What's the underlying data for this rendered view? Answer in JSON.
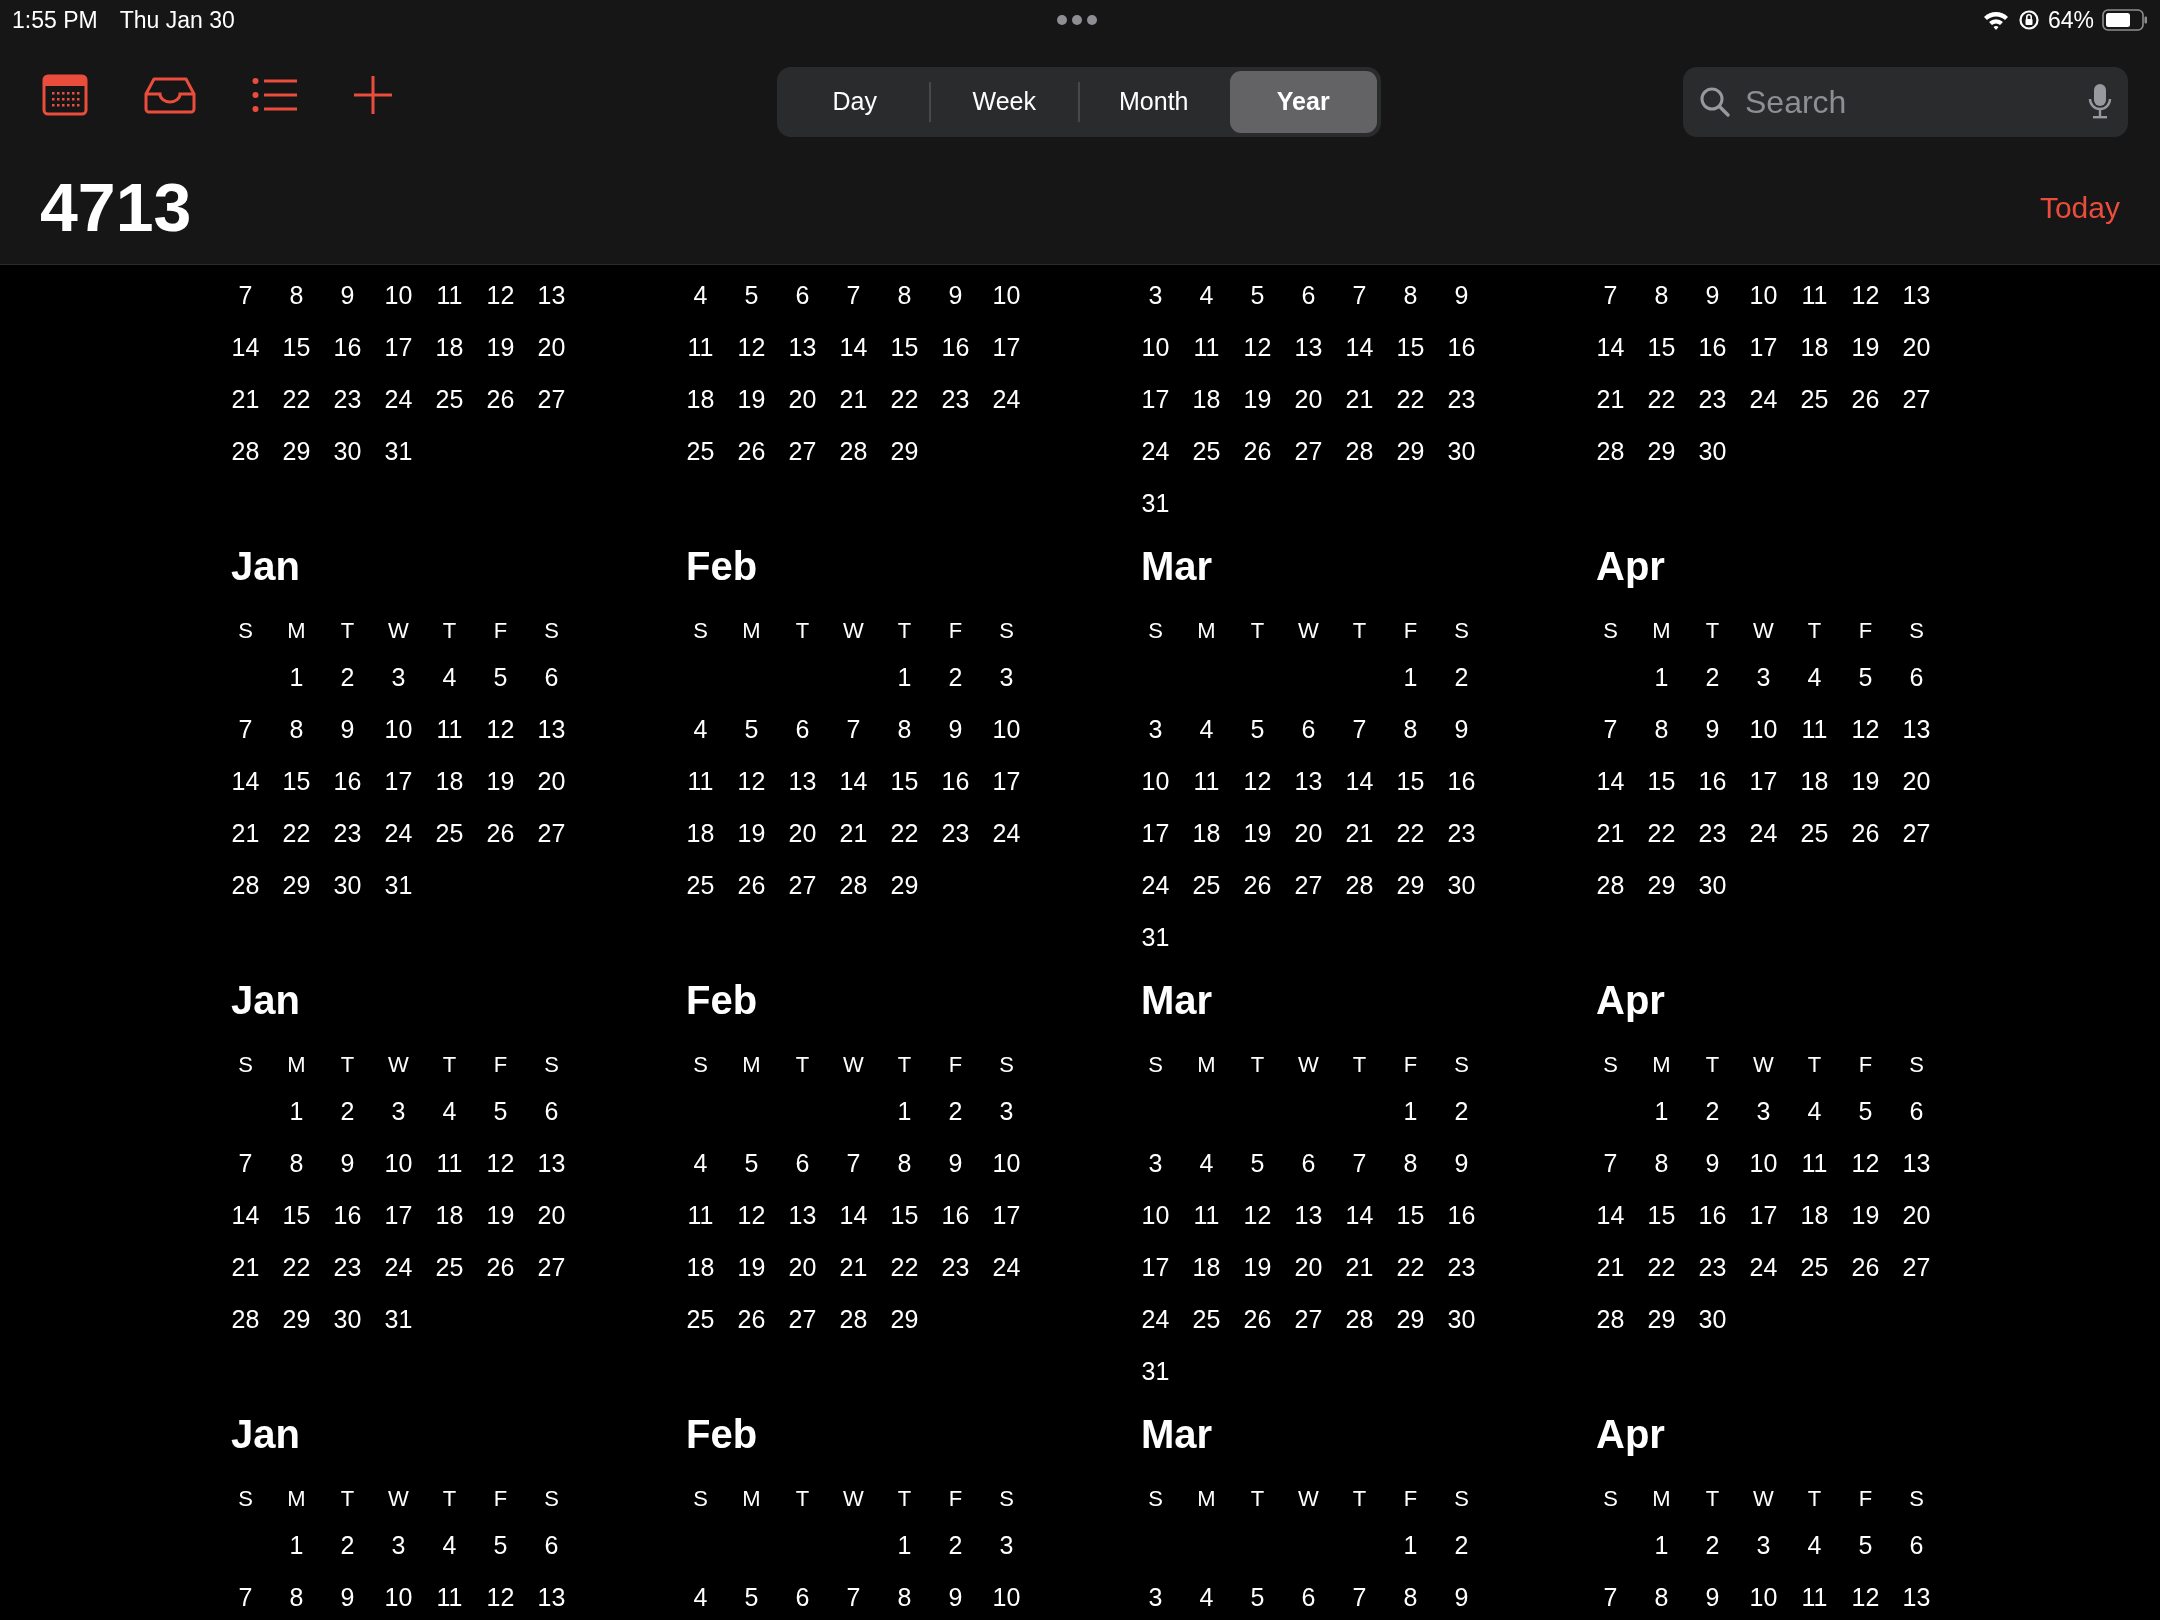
{
  "status_bar": {
    "time": "1:55 PM",
    "date": "Thu Jan 30",
    "battery": "64%"
  },
  "toolbar": {
    "view_tabs": [
      {
        "label": "Day",
        "selected": false
      },
      {
        "label": "Week",
        "selected": false
      },
      {
        "label": "Month",
        "selected": false
      },
      {
        "label": "Year",
        "selected": true
      }
    ],
    "search": {
      "placeholder": "Search"
    }
  },
  "title": "4713",
  "today_button": "Today",
  "sections": [
    {
      "months": [
        {
          "weeks": [
            {
              "kind": "week",
              "days": [
                "7",
                "8",
                "9",
                "10",
                "11",
                "12",
                "13"
              ]
            },
            {
              "kind": "week",
              "days": [
                "14",
                "15",
                "16",
                "17",
                "18",
                "19",
                "20"
              ]
            },
            {
              "kind": "week",
              "days": [
                "21",
                "22",
                "23",
                "24",
                "25",
                "26",
                "27"
              ]
            },
            {
              "kind": "week",
              "days": [
                "28",
                "29",
                "30",
                "31"
              ]
            }
          ]
        },
        {
          "weeks": [
            {
              "kind": "week",
              "days": [
                "4",
                "5",
                "6",
                "7",
                "8",
                "9",
                "10"
              ]
            },
            {
              "kind": "week",
              "days": [
                "11",
                "12",
                "13",
                "14",
                "15",
                "16",
                "17"
              ]
            },
            {
              "kind": "week",
              "days": [
                "18",
                "19",
                "20",
                "21",
                "22",
                "23",
                "24"
              ]
            },
            {
              "kind": "week",
              "days": [
                "25",
                "26",
                "27",
                "28",
                "29"
              ]
            }
          ]
        },
        {
          "weeks": [
            {
              "kind": "week",
              "days": [
                "3",
                "4",
                "5",
                "6",
                "7",
                "8",
                "9"
              ]
            },
            {
              "kind": "week",
              "days": [
                "10",
                "11",
                "12",
                "13",
                "14",
                "15",
                "16"
              ]
            },
            {
              "kind": "week",
              "days": [
                "17",
                "18",
                "19",
                "20",
                "21",
                "22",
                "23"
              ]
            },
            {
              "kind": "week",
              "days": [
                "24",
                "25",
                "26",
                "27",
                "28",
                "29",
                "30"
              ]
            },
            {
              "kind": "week",
              "days": [
                "31"
              ]
            }
          ]
        },
        {
          "weeks": [
            {
              "kind": "week",
              "days": [
                "7",
                "8",
                "9",
                "10",
                "11",
                "12",
                "13"
              ]
            },
            {
              "kind": "week",
              "days": [
                "14",
                "15",
                "16",
                "17",
                "18",
                "19",
                "20"
              ]
            },
            {
              "kind": "week",
              "days": [
                "21",
                "22",
                "23",
                "24",
                "25",
                "26",
                "27"
              ]
            },
            {
              "kind": "week",
              "days": [
                "28",
                "29",
                "30"
              ]
            }
          ]
        }
      ]
    },
    {
      "months": [
        {
          "name": "Jan",
          "weekdays": [
            "S",
            "M",
            "T",
            "W",
            "T",
            "F",
            "S"
          ],
          "weeks": [
            {
              "kind": "lead",
              "days": [
                "1",
                "2",
                "3",
                "4",
                "5",
                "6"
              ]
            },
            {
              "kind": "week",
              "days": [
                "7",
                "8",
                "9",
                "10",
                "11",
                "12",
                "13"
              ]
            },
            {
              "kind": "week",
              "days": [
                "14",
                "15",
                "16",
                "17",
                "18",
                "19",
                "20"
              ]
            },
            {
              "kind": "week",
              "days": [
                "21",
                "22",
                "23",
                "24",
                "25",
                "26",
                "27"
              ]
            },
            {
              "kind": "week",
              "days": [
                "28",
                "29",
                "30",
                "31"
              ]
            }
          ]
        },
        {
          "name": "Feb",
          "weekdays": [
            "S",
            "M",
            "T",
            "W",
            "T",
            "F",
            "S"
          ],
          "weeks": [
            {
              "kind": "lead",
              "days": [
                "1",
                "2",
                "3"
              ]
            },
            {
              "kind": "week",
              "days": [
                "4",
                "5",
                "6",
                "7",
                "8",
                "9",
                "10"
              ]
            },
            {
              "kind": "week",
              "days": [
                "11",
                "12",
                "13",
                "14",
                "15",
                "16",
                "17"
              ]
            },
            {
              "kind": "week",
              "days": [
                "18",
                "19",
                "20",
                "21",
                "22",
                "23",
                "24"
              ]
            },
            {
              "kind": "week",
              "days": [
                "25",
                "26",
                "27",
                "28",
                "29"
              ]
            }
          ]
        },
        {
          "name": "Mar",
          "weekdays": [
            "S",
            "M",
            "T",
            "W",
            "T",
            "F",
            "S"
          ],
          "weeks": [
            {
              "kind": "lead",
              "days": [
                "1",
                "2"
              ]
            },
            {
              "kind": "week",
              "days": [
                "3",
                "4",
                "5",
                "6",
                "7",
                "8",
                "9"
              ]
            },
            {
              "kind": "week",
              "days": [
                "10",
                "11",
                "12",
                "13",
                "14",
                "15",
                "16"
              ]
            },
            {
              "kind": "week",
              "days": [
                "17",
                "18",
                "19",
                "20",
                "21",
                "22",
                "23"
              ]
            },
            {
              "kind": "week",
              "days": [
                "24",
                "25",
                "26",
                "27",
                "28",
                "29",
                "30"
              ]
            },
            {
              "kind": "week",
              "days": [
                "31"
              ]
            }
          ]
        },
        {
          "name": "Apr",
          "weekdays": [
            "S",
            "M",
            "T",
            "W",
            "T",
            "F",
            "S"
          ],
          "weeks": [
            {
              "kind": "lead",
              "days": [
                "1",
                "2",
                "3",
                "4",
                "5",
                "6"
              ]
            },
            {
              "kind": "week",
              "days": [
                "7",
                "8",
                "9",
                "10",
                "11",
                "12",
                "13"
              ]
            },
            {
              "kind": "week",
              "days": [
                "14",
                "15",
                "16",
                "17",
                "18",
                "19",
                "20"
              ]
            },
            {
              "kind": "week",
              "days": [
                "21",
                "22",
                "23",
                "24",
                "25",
                "26",
                "27"
              ]
            },
            {
              "kind": "week",
              "days": [
                "28",
                "29",
                "30"
              ]
            }
          ]
        }
      ]
    },
    {
      "months": [
        {
          "name": "Jan",
          "weekdays": [
            "S",
            "M",
            "T",
            "W",
            "T",
            "F",
            "S"
          ],
          "weeks": [
            {
              "kind": "lead",
              "days": [
                "1",
                "2",
                "3",
                "4",
                "5",
                "6"
              ]
            },
            {
              "kind": "week",
              "days": [
                "7",
                "8",
                "9",
                "10",
                "11",
                "12",
                "13"
              ]
            },
            {
              "kind": "week",
              "days": [
                "14",
                "15",
                "16",
                "17",
                "18",
                "19",
                "20"
              ]
            },
            {
              "kind": "week",
              "days": [
                "21",
                "22",
                "23",
                "24",
                "25",
                "26",
                "27"
              ]
            },
            {
              "kind": "week",
              "days": [
                "28",
                "29",
                "30",
                "31"
              ]
            }
          ]
        },
        {
          "name": "Feb",
          "weekdays": [
            "S",
            "M",
            "T",
            "W",
            "T",
            "F",
            "S"
          ],
          "weeks": [
            {
              "kind": "lead",
              "days": [
                "1",
                "2",
                "3"
              ]
            },
            {
              "kind": "week",
              "days": [
                "4",
                "5",
                "6",
                "7",
                "8",
                "9",
                "10"
              ]
            },
            {
              "kind": "week",
              "days": [
                "11",
                "12",
                "13",
                "14",
                "15",
                "16",
                "17"
              ]
            },
            {
              "kind": "week",
              "days": [
                "18",
                "19",
                "20",
                "21",
                "22",
                "23",
                "24"
              ]
            },
            {
              "kind": "week",
              "days": [
                "25",
                "26",
                "27",
                "28",
                "29"
              ]
            }
          ]
        },
        {
          "name": "Mar",
          "weekdays": [
            "S",
            "M",
            "T",
            "W",
            "T",
            "F",
            "S"
          ],
          "weeks": [
            {
              "kind": "lead",
              "days": [
                "1",
                "2"
              ]
            },
            {
              "kind": "week",
              "days": [
                "3",
                "4",
                "5",
                "6",
                "7",
                "8",
                "9"
              ]
            },
            {
              "kind": "week",
              "days": [
                "10",
                "11",
                "12",
                "13",
                "14",
                "15",
                "16"
              ]
            },
            {
              "kind": "week",
              "days": [
                "17",
                "18",
                "19",
                "20",
                "21",
                "22",
                "23"
              ]
            },
            {
              "kind": "week",
              "days": [
                "24",
                "25",
                "26",
                "27",
                "28",
                "29",
                "30"
              ]
            },
            {
              "kind": "week",
              "days": [
                "31"
              ]
            }
          ]
        },
        {
          "name": "Apr",
          "weekdays": [
            "S",
            "M",
            "T",
            "W",
            "T",
            "F",
            "S"
          ],
          "weeks": [
            {
              "kind": "lead",
              "days": [
                "1",
                "2",
                "3",
                "4",
                "5",
                "6"
              ]
            },
            {
              "kind": "week",
              "days": [
                "7",
                "8",
                "9",
                "10",
                "11",
                "12",
                "13"
              ]
            },
            {
              "kind": "week",
              "days": [
                "14",
                "15",
                "16",
                "17",
                "18",
                "19",
                "20"
              ]
            },
            {
              "kind": "week",
              "days": [
                "21",
                "22",
                "23",
                "24",
                "25",
                "26",
                "27"
              ]
            },
            {
              "kind": "week",
              "days": [
                "28",
                "29",
                "30"
              ]
            }
          ]
        }
      ]
    },
    {
      "months": [
        {
          "name": "Jan",
          "weekdays": [
            "S",
            "M",
            "T",
            "W",
            "T",
            "F",
            "S"
          ],
          "weeks": [
            {
              "kind": "lead",
              "days": [
                "1",
                "2",
                "3",
                "4",
                "5",
                "6"
              ]
            },
            {
              "kind": "week",
              "days": [
                "7",
                "8",
                "9",
                "10",
                "11",
                "12",
                "13"
              ]
            }
          ]
        },
        {
          "name": "Feb",
          "weekdays": [
            "S",
            "M",
            "T",
            "W",
            "T",
            "F",
            "S"
          ],
          "weeks": [
            {
              "kind": "lead",
              "days": [
                "1",
                "2",
                "3"
              ]
            },
            {
              "kind": "week",
              "days": [
                "4",
                "5",
                "6",
                "7",
                "8",
                "9",
                "10"
              ]
            }
          ]
        },
        {
          "name": "Mar",
          "weekdays": [
            "S",
            "M",
            "T",
            "W",
            "T",
            "F",
            "S"
          ],
          "weeks": [
            {
              "kind": "lead",
              "days": [
                "1",
                "2"
              ]
            },
            {
              "kind": "week",
              "days": [
                "3",
                "4",
                "5",
                "6",
                "7",
                "8",
                "9"
              ]
            }
          ]
        },
        {
          "name": "Apr",
          "weekdays": [
            "S",
            "M",
            "T",
            "W",
            "T",
            "F",
            "S"
          ],
          "weeks": [
            {
              "kind": "lead",
              "days": [
                "1",
                "2",
                "3",
                "4",
                "5",
                "6"
              ]
            },
            {
              "kind": "week",
              "days": [
                "7",
                "8",
                "9",
                "10",
                "11",
                "12",
                "13"
              ]
            }
          ]
        }
      ]
    }
  ]
}
